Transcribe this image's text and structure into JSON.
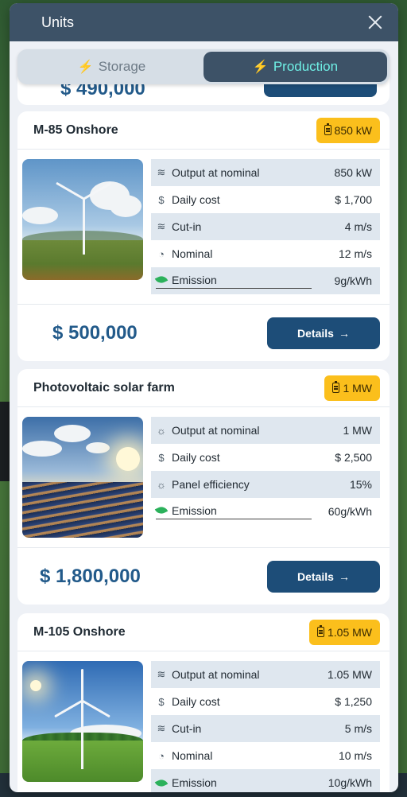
{
  "modal": {
    "title": "Units"
  },
  "tabs": [
    {
      "label": "Storage",
      "icon": "battery-charging-icon",
      "active": false
    },
    {
      "label": "Production",
      "icon": "lightning-icon",
      "active": true
    }
  ],
  "peek": {
    "price": "$ 490,000"
  },
  "units": [
    {
      "title": "M-85 Onshore",
      "badge": "850 kW",
      "image": "wind-turbine-image",
      "specs": [
        {
          "icon": "wind-icon",
          "label": "Output at nominal",
          "value": "850 kW"
        },
        {
          "icon": "dollar-icon",
          "label": "Daily cost",
          "value": "$ 1,700"
        },
        {
          "icon": "wind-icon",
          "label": "Cut-in",
          "value": "4 m/s"
        },
        {
          "icon": "gauge-icon",
          "label": "Nominal",
          "value": "12 m/s"
        },
        {
          "icon": "leaf-icon",
          "label": "Emission",
          "value": "9g/kWh"
        }
      ],
      "price": "$ 500,000",
      "details_label": "Details"
    },
    {
      "title": "Photovoltaic solar farm",
      "badge": "1 MW",
      "image": "solar-farm-image",
      "specs": [
        {
          "icon": "sun-icon",
          "label": "Output at nominal",
          "value": "1 MW"
        },
        {
          "icon": "dollar-icon",
          "label": "Daily cost",
          "value": "$ 2,500"
        },
        {
          "icon": "sun-icon",
          "label": "Panel efficiency",
          "value": "15%"
        },
        {
          "icon": "leaf-icon",
          "label": "Emission",
          "value": "60g/kWh"
        }
      ],
      "price": "$ 1,800,000",
      "details_label": "Details"
    },
    {
      "title": "M-105 Onshore",
      "badge": "1.05 MW",
      "image": "wind-turbine-image",
      "specs": [
        {
          "icon": "wind-icon",
          "label": "Output at nominal",
          "value": "1.05 MW"
        },
        {
          "icon": "dollar-icon",
          "label": "Daily cost",
          "value": "$ 1,250"
        },
        {
          "icon": "wind-icon",
          "label": "Cut-in",
          "value": "5 m/s"
        },
        {
          "icon": "gauge-icon",
          "label": "Nominal",
          "value": "10 m/s"
        },
        {
          "icon": "leaf-icon",
          "label": "Emission",
          "value": "10g/kWh"
        }
      ]
    }
  ]
}
